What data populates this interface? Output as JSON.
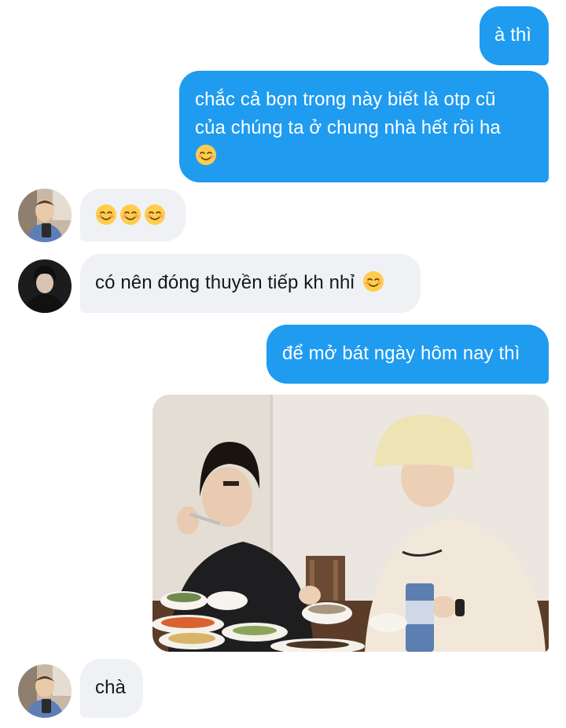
{
  "messages": [
    {
      "id": "m1",
      "side": "out",
      "text": "à thì"
    },
    {
      "id": "m2",
      "side": "out",
      "lines": [
        "chắc cả bọn trong này biết là otp cũ",
        "của chúng ta ở chung nhà hết rồi ha"
      ],
      "emoji": "smiling-face-icon"
    },
    {
      "id": "m3",
      "side": "in",
      "emoji_count": 3,
      "emoji": "smiling-face-icon"
    },
    {
      "id": "m4",
      "side": "in",
      "text": "có nên đóng thuyền tiếp kh nhỉ",
      "emoji": "smiling-face-icon"
    },
    {
      "id": "m5",
      "side": "out",
      "text": "để mở bát ngày hôm nay thì"
    },
    {
      "id": "m6",
      "side": "out",
      "image": "photo-two-people-eating-at-table"
    },
    {
      "id": "m7",
      "side": "in",
      "text": "chà"
    }
  ],
  "colors": {
    "outgoing_bubble": "#1f9bf0",
    "incoming_bubble": "#eff1f4",
    "outgoing_text": "#ffffff",
    "incoming_text": "#16181c"
  }
}
